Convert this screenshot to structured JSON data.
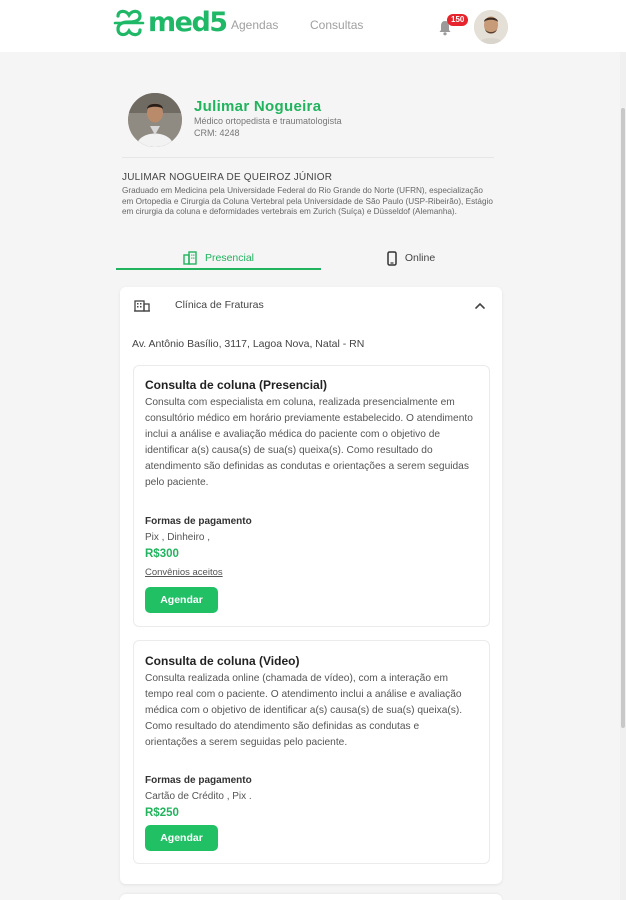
{
  "header": {
    "logo_text": "med5",
    "nav": [
      "Agendas",
      "Consultas"
    ],
    "notification_count": "150",
    "brand_color": "#1fb867"
  },
  "doctor": {
    "name": "Julimar Nogueira",
    "specialty": "Médico ortopedista e traumatologista",
    "crm": "CRM: 4248",
    "full_name": "JULIMAR NOGUEIRA DE QUEIROZ JÚNIOR",
    "bio": "Graduado em Medicina pela Universidade Federal do Rio Grande do Norte (UFRN), especialização em Ortopedia e Cirurgia da Coluna Vertebral pela Universidade de São Paulo (USP-Ribeirão), Estágio em cirurgia da coluna e deformidades vertebrais em Zurich (Suíça) e Düsseldof (Alemanha)."
  },
  "tabs": {
    "presencial": "Presencial",
    "online": "Online",
    "active": "presencial"
  },
  "clinic": {
    "name": "Clínica de Fraturas",
    "address": "Av. Antônio Basílio, 3117, Lagoa Nova, Natal - RN"
  },
  "services": [
    {
      "title": "Consulta de coluna (Presencial)",
      "description": "Consulta com especialista em coluna, realizada presencialmente em consultório médico em horário previamente estabelecido. O atendimento inclui a análise e avaliação médica do paciente com o objetivo de identificar a(s) causa(s) de sua(s) queixa(s). Como resultado do atendimento são definidas as condutas e orientações a serem seguidas pelo paciente.",
      "payment_label": "Formas de pagamento",
      "payment_methods": "Pix , Dinheiro ,",
      "price": "R$300",
      "insurance_link": "Convênios aceitos",
      "button": "Agendar"
    },
    {
      "title": "Consulta de coluna (Video)",
      "description": "Consulta realizada online (chamada de vídeo), com a interação em tempo real com o paciente. O atendimento inclui a análise e avaliação médica com o objetivo de identificar a(s) causa(s) de sua(s) queixa(s). Como resultado do atendimento são definidas as condutas e orientações a serem seguidas pelo paciente.",
      "payment_label": "Formas de pagamento",
      "payment_methods": "Cartão de Crédito , Pix .",
      "price": "R$250",
      "button": "Agendar"
    }
  ]
}
